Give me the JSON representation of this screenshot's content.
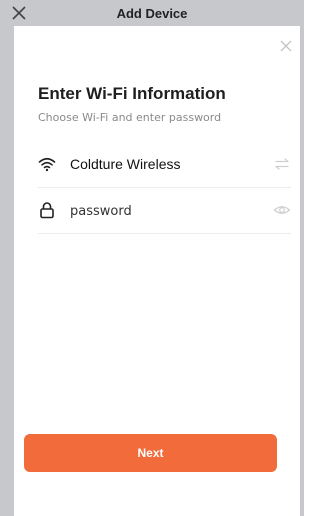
{
  "window": {
    "title": "Add Device",
    "close_icon": "close-icon"
  },
  "sheet": {
    "close_icon": "close-icon",
    "heading": "Enter Wi-Fi Information",
    "subheading": "Choose Wi-Fi and enter password"
  },
  "wifi": {
    "icon": "wifi-icon",
    "ssid": "Coldture Wireless",
    "switch_icon": "swap-icon"
  },
  "password": {
    "icon": "lock-icon",
    "value": "",
    "placeholder": "password",
    "visibility_icon": "eye-icon"
  },
  "actions": {
    "next_label": "Next"
  },
  "colors": {
    "accent": "#f26b3a",
    "backdrop": "#c6c8cc",
    "divider": "#ececec",
    "muted_text": "#8a8a8a"
  }
}
